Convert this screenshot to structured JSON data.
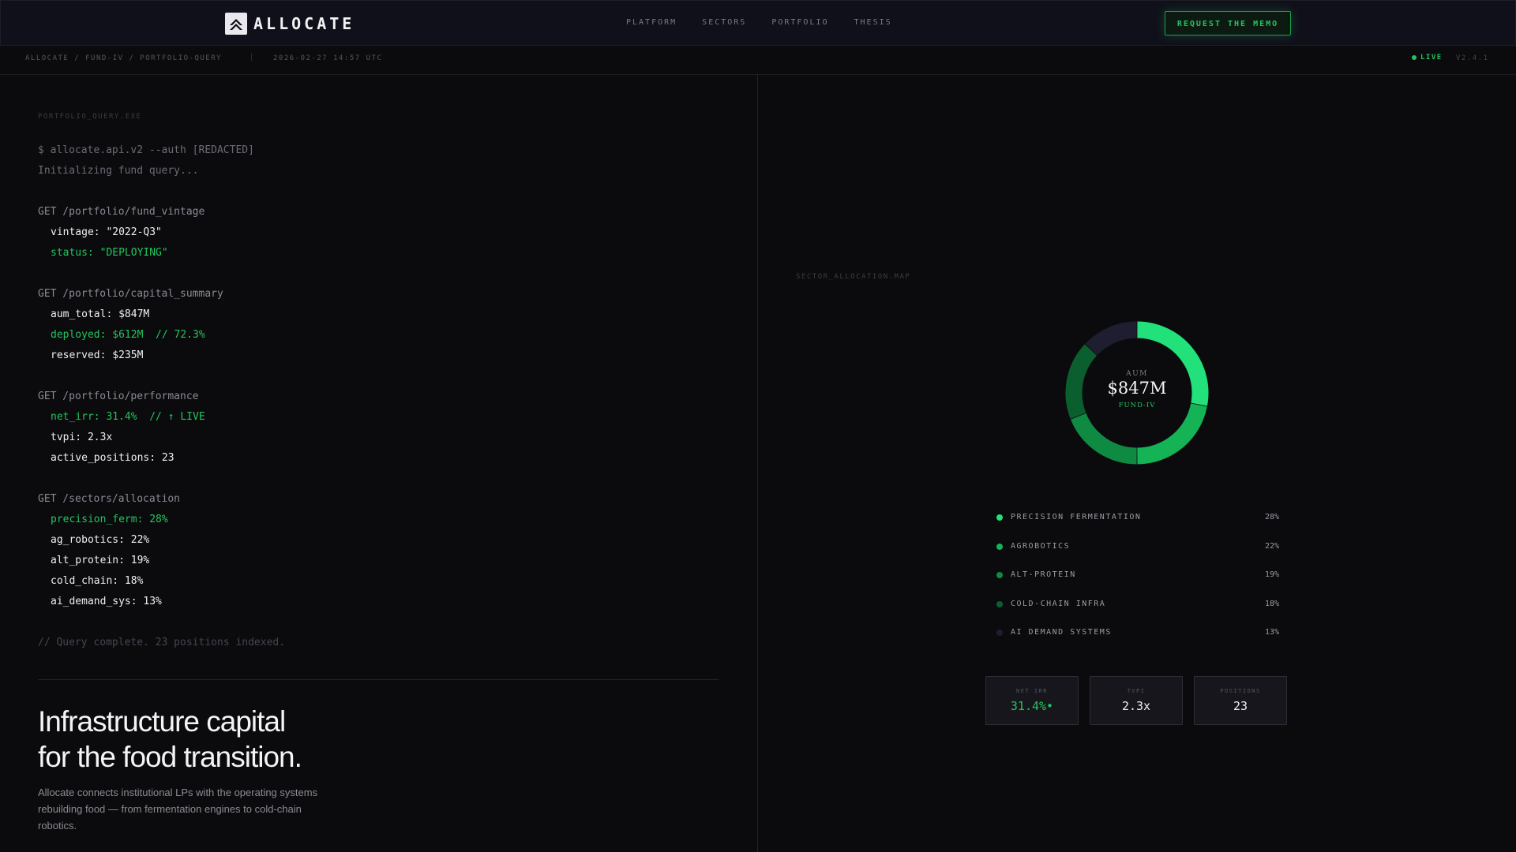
{
  "header": {
    "brand": "ALLOCATE",
    "nav": [
      "PLATFORM",
      "SECTORS",
      "PORTFOLIO",
      "THESIS"
    ],
    "cta_label": "REQUEST THE MEMO"
  },
  "statusbar": {
    "breadcrumb": "ALLOCATE / FUND-IV / PORTFOLIO-QUERY",
    "separator": "|",
    "timestamp": "2026-02-27 14:57 UTC",
    "live_label": "LIVE",
    "version": "V2.4.1"
  },
  "terminal": {
    "label": "PORTFOLIO_QUERY.EXE",
    "lines": [
      {
        "text": "$ allocate.api.v2 --auth [REDACTED]",
        "style": "dim"
      },
      {
        "text": "Initializing fund query...",
        "style": "dim"
      },
      {
        "text": "",
        "style": "blank"
      },
      {
        "text": "GET /portfolio/fund_vintage",
        "style": "req"
      },
      {
        "text": "vintage: \"2022-Q3\"",
        "style": "val"
      },
      {
        "text": "status: \"DEPLOYING\"",
        "style": "green"
      },
      {
        "text": "",
        "style": "blank"
      },
      {
        "text": "GET /portfolio/capital_summary",
        "style": "req"
      },
      {
        "text": "aum_total: $847M",
        "style": "val"
      },
      {
        "text": "deployed: $612M  // 72.3%",
        "style": "green"
      },
      {
        "text": "reserved: $235M",
        "style": "val"
      },
      {
        "text": "",
        "style": "blank"
      },
      {
        "text": "GET /portfolio/performance",
        "style": "req"
      },
      {
        "text": "net_irr: 31.4%  // ↑ LIVE",
        "style": "green"
      },
      {
        "text": "tvpi: 2.3x",
        "style": "val"
      },
      {
        "text": "active_positions: 23",
        "style": "val"
      },
      {
        "text": "",
        "style": "blank"
      },
      {
        "text": "GET /sectors/allocation",
        "style": "req"
      },
      {
        "text": "precision_ferm: 28%",
        "style": "green"
      },
      {
        "text": "ag_robotics: 22%",
        "style": "val"
      },
      {
        "text": "alt_protein: 19%",
        "style": "val"
      },
      {
        "text": "cold_chain: 18%",
        "style": "val"
      },
      {
        "text": "ai_demand_sys: 13%",
        "style": "val"
      },
      {
        "text": "",
        "style": "blank"
      },
      {
        "text": "// Query complete. 23 positions indexed.",
        "style": "comment"
      }
    ]
  },
  "hero": {
    "headline_line1": "Infrastructure capital",
    "headline_line2": "for the food transition.",
    "subcopy": "Allocate connects institutional LPs with the operating systems rebuilding food — from fermentation engines to cold-chain robotics."
  },
  "allocation": {
    "label": "SECTOR_ALLOCATION.MAP",
    "center_label": "AUM",
    "center_value": "$847M",
    "center_sub": "FUND-IV",
    "sectors": [
      {
        "name": "PRECISION FERMENTATION",
        "pct_label": "28%",
        "value": 28,
        "color": "#22e07a"
      },
      {
        "name": "AGROBOTICS",
        "pct_label": "22%",
        "value": 22,
        "color": "#14b356"
      },
      {
        "name": "ALT-PROTEIN",
        "pct_label": "19%",
        "value": 19,
        "color": "#0f8a42"
      },
      {
        "name": "COLD-CHAIN INFRA",
        "pct_label": "18%",
        "value": 18,
        "color": "#0b5f2e"
      },
      {
        "name": "AI DEMAND SYSTEMS",
        "pct_label": "13%",
        "value": 13,
        "color": "#1e1e30"
      }
    ]
  },
  "stats": [
    {
      "label": "NET IRR",
      "value": "31.4%•",
      "accent": true
    },
    {
      "label": "TVPI",
      "value": "2.3x",
      "accent": false
    },
    {
      "label": "POSITIONS",
      "value": "23",
      "accent": false
    }
  ]
}
